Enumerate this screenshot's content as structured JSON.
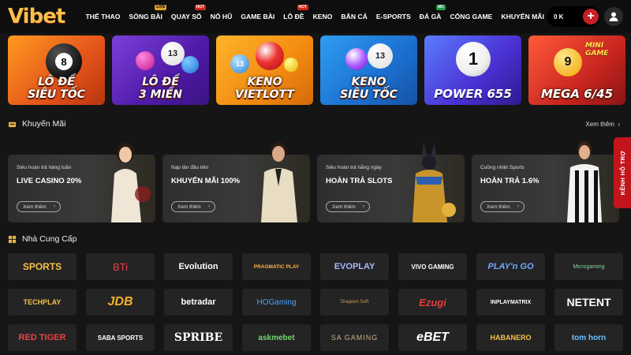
{
  "header": {
    "logo": "Vibet",
    "nav": [
      {
        "label": "THỂ THAO",
        "badge": ""
      },
      {
        "label": "SÒNG BÀI",
        "badge": "LIVE"
      },
      {
        "label": "QUAY SỐ",
        "badge": "HOT"
      },
      {
        "label": "NỔ HŨ",
        "badge": ""
      },
      {
        "label": "GAME BÀI",
        "badge": ""
      },
      {
        "label": "LÔ ĐỀ",
        "badge": "HOT"
      },
      {
        "label": "KENO",
        "badge": ""
      },
      {
        "label": "BẮN CÁ",
        "badge": ""
      },
      {
        "label": "E-SPORTS",
        "badge": ""
      },
      {
        "label": "ĐÁ GÀ",
        "badge": "MC"
      },
      {
        "label": "CỔNG GAME",
        "badge": ""
      },
      {
        "label": "KHUYẾN MÃI",
        "badge": ""
      }
    ],
    "balance": "0 K",
    "plus": "+"
  },
  "games": [
    {
      "line1": "LÔ ĐỀ",
      "line2": "SIÊU TỐC",
      "ball": "8"
    },
    {
      "line1": "LÔ ĐỀ",
      "line2": "3 MIỀN",
      "ball": "13"
    },
    {
      "line1": "KENO",
      "line2": "VIETLOTT",
      "ball": "13"
    },
    {
      "line1": "KENO",
      "line2": "SIÊU TỐC",
      "ball": "13"
    },
    {
      "line1": "",
      "line2": "POWER 655",
      "ball": "1"
    },
    {
      "line1": "MINI GAME",
      "line2": "MEGA 6/45",
      "ball": "9"
    }
  ],
  "promotions": {
    "title": "Khuyến Mãi",
    "see_more": "Xem thêm",
    "items": [
      {
        "subtitle": "Siêu hoàn trả hàng tuần",
        "title": "LIVE CASINO 20%",
        "button": "Xem thêm"
      },
      {
        "subtitle": "Nạp lần đầu tiên",
        "title": "KHUYẾN MÃI 100%",
        "button": "Xem thêm"
      },
      {
        "subtitle": "Siêu hoàn trả hằng ngày",
        "title": "HOÀN TRẢ SLOTS",
        "button": "Xem thêm"
      },
      {
        "subtitle": "Cuồng nhiệt Sports",
        "title": "HOÀN TRẢ 1.6%",
        "button": "Xem thêm"
      }
    ]
  },
  "providers": {
    "title": "Nhà Cung Cấp",
    "items": [
      "SPORTS",
      "BTi",
      "Evolution",
      "PRAGMATIC PLAY",
      "EVOPLAY",
      "VIVO GAMING",
      "PLAY'n GO",
      "Microgaming",
      "TECHPLAY",
      "JDB",
      "betradar",
      "HOGaming",
      "Dragoon Soft",
      "Ezugi",
      "INPLAYMATRIX",
      "NETENT",
      "RED TIGER",
      "SABA SPORTS",
      "SPRIBE",
      "askmebet",
      "SA GAMING",
      "eBET",
      "HABANERO",
      "tom horn"
    ]
  },
  "side_tab": "KÊNH HỖ TRỢ",
  "colors": {
    "accent_red": "#c62026",
    "gold": "#f7c04a",
    "background": "#151515"
  }
}
